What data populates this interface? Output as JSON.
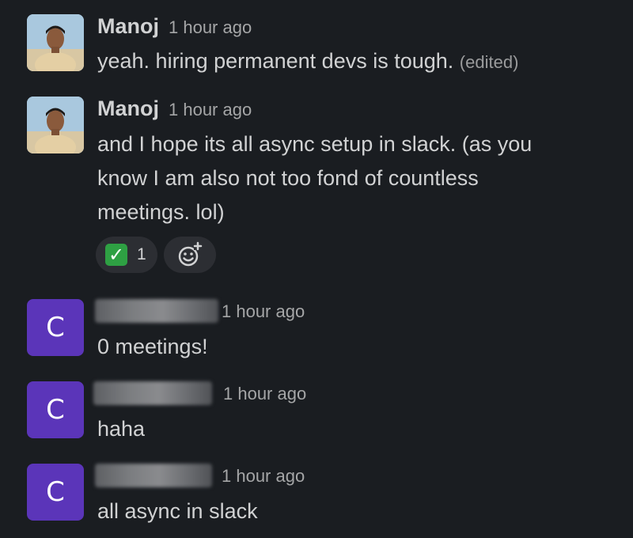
{
  "messages": [
    {
      "author": "Manoj",
      "avatar": "photo",
      "time": "1 hour ago",
      "lines": [
        "yeah. hiring permanent devs is tough."
      ],
      "edited": "(edited)"
    },
    {
      "author": "Manoj",
      "avatar": "photo",
      "time": "1 hour ago",
      "lines": [
        "and I hope its all async setup in slack. (as you",
        "know I am also not too fond of countless",
        "meetings. lol)"
      ],
      "reactions": [
        {
          "emoji": "white-check-mark-icon",
          "glyph": "✓",
          "count": "1"
        }
      ]
    },
    {
      "author_redacted": true,
      "avatar_letter": "C",
      "time": "1 hour ago",
      "lines": [
        "0 meetings!"
      ]
    },
    {
      "author_redacted": true,
      "avatar_letter": "C",
      "time": "1 hour ago",
      "lines": [
        "haha"
      ]
    },
    {
      "author_redacted": true,
      "avatar_letter": "C",
      "time": "1 hour ago",
      "lines": [
        "all async in slack"
      ]
    }
  ],
  "colors": {
    "background": "#1a1d21",
    "avatar_letter_bg": "#5b35b9",
    "reaction_bg": "#2c2e33",
    "check_green": "#2ea043"
  }
}
